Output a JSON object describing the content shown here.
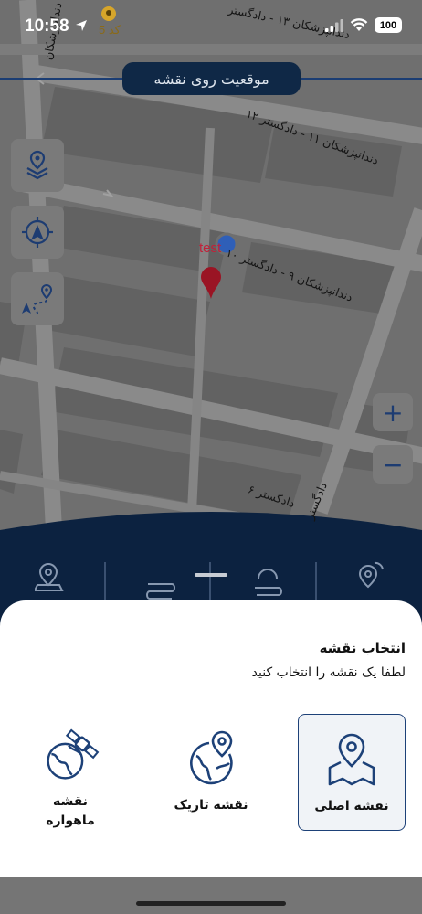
{
  "status_bar": {
    "time": "10:58",
    "battery": "100",
    "store_badge": "کد 5"
  },
  "header": {
    "title": "موقعیت روی نقشه"
  },
  "map": {
    "marker_caption": "test",
    "street_labels": [
      "دندانپزشکان ۱۳ - دادگستر",
      "دندانپزشکان ۱۱ - دادگستر ۱۲",
      "دندانپزشکان ۹ - دادگستر ۱۰",
      "دادگستر ۶",
      "دادگستر",
      "دندانپزشکان"
    ]
  },
  "controls": {
    "layers": "layers-icon",
    "locate": "crosshair-icon",
    "route": "route-icon",
    "zoom_in": "+",
    "zoom_out": "−"
  },
  "sheet": {
    "title": "انتخاب نقشه",
    "subtitle": "لطفا یک نقشه را انتخاب کنید",
    "options": [
      {
        "label": "نقشه اصلی",
        "icon": "map-pin-icon",
        "selected": true
      },
      {
        "label": "نقشه تاریک",
        "icon": "globe-pin-icon",
        "selected": false
      },
      {
        "label": "نقشه ماهواره",
        "icon": "satellite-icon",
        "selected": false
      }
    ]
  },
  "colors": {
    "brand_navy": "#0f2846",
    "accent_blue": "#1d4178",
    "marker_red": "#c0223a"
  }
}
